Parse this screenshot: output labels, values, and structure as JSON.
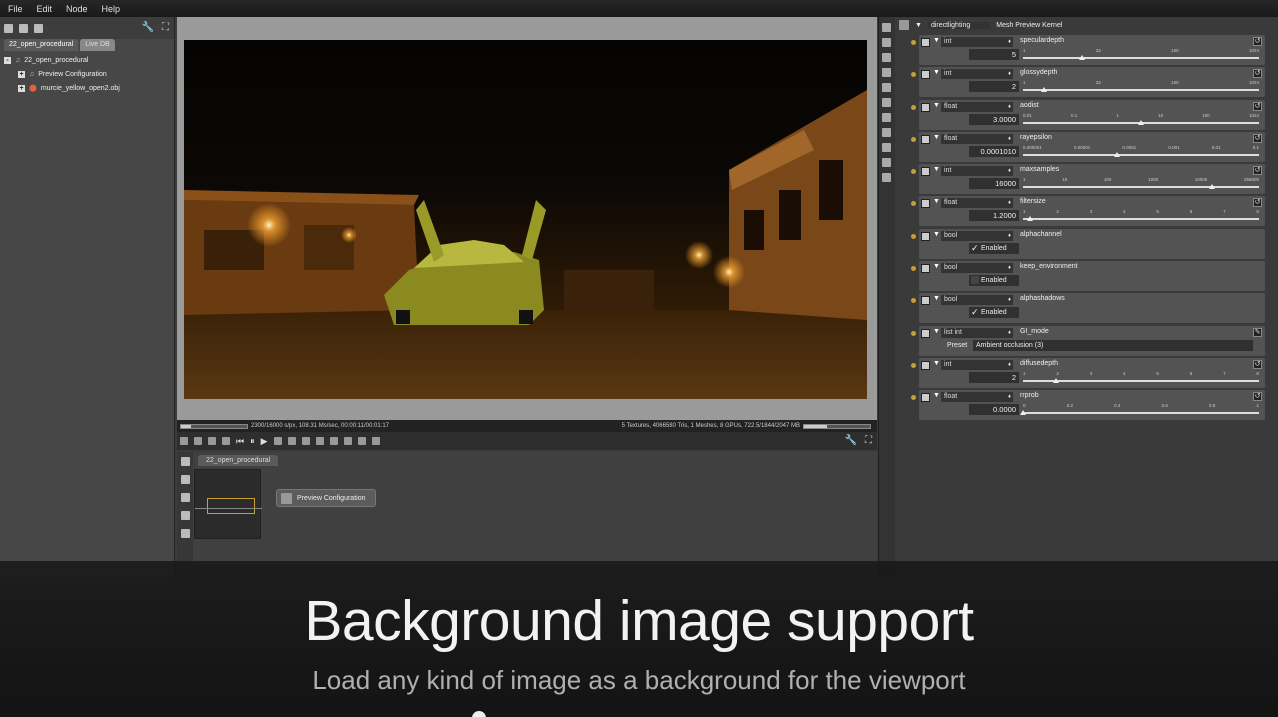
{
  "menu": {
    "file": "File",
    "edit": "Edit",
    "node": "Node",
    "help": "Help"
  },
  "left": {
    "tab_active": "22_open_procedural",
    "tab_inactive": "Live DB",
    "tree": {
      "root": "22_open_procedural",
      "child1": "Preview Configuration",
      "child2": "murcie_yellow_open2.obj"
    }
  },
  "status": {
    "left": "2300/16000 s/px, 108.31 Ms/sec, 00:00:11/00:01:17",
    "right": "5 Textures, 4066580 Tris, 1 Meshes, 8 GPUs, 722.5/1844/2047 MB",
    "progress": 0.15,
    "mem": 0.35
  },
  "graph": {
    "tab": "22_open_procedural",
    "node": "Preview Configuration"
  },
  "kernel": {
    "type": "directlighting",
    "name": "Mesh Preview Kernel"
  },
  "params": [
    {
      "type": "int",
      "name": "speculardepth",
      "value": "5",
      "ticks": [
        "1",
        "32",
        "100",
        "1024"
      ],
      "pos": 0.25
    },
    {
      "type": "int",
      "name": "glossydepth",
      "value": "2",
      "ticks": [
        "1",
        "32",
        "100",
        "1024"
      ],
      "pos": 0.09
    },
    {
      "type": "float",
      "name": "aodist",
      "value": "3.0000",
      "ticks": [
        "0.01",
        "0.1",
        "1",
        "10",
        "100",
        "1024"
      ],
      "pos": 0.5
    },
    {
      "type": "float",
      "name": "rayepsilon",
      "value": "0.0001010",
      "ticks": [
        "0.000001",
        "0.00001",
        "0.0001",
        "0.001",
        "0.01",
        "0.1"
      ],
      "pos": 0.4
    },
    {
      "type": "int",
      "name": "maxsamples",
      "value": "16000",
      "ticks": [
        "1",
        "10",
        "100",
        "1000",
        "10000",
        "256000"
      ],
      "pos": 0.8
    },
    {
      "type": "float",
      "name": "filtersize",
      "value": "1.2000",
      "ticks": [
        "1",
        "2",
        "3",
        "4",
        "5",
        "6",
        "7",
        "8"
      ],
      "pos": 0.03
    },
    {
      "type": "bool",
      "name": "alphachannel",
      "checked": true,
      "label": "Enabled"
    },
    {
      "type": "bool",
      "name": "keep_environment",
      "checked": false,
      "label": "Enabled"
    },
    {
      "type": "bool",
      "name": "alphashadows",
      "checked": true,
      "label": "Enabled"
    },
    {
      "type": "list int",
      "name": "GI_mode",
      "preset_label": "Preset",
      "preset": "Ambient occlusion (3)"
    },
    {
      "type": "int",
      "name": "diffusedepth",
      "value": "2",
      "ticks": [
        "1",
        "2",
        "3",
        "4",
        "5",
        "6",
        "7",
        "8"
      ],
      "pos": 0.14
    },
    {
      "type": "float",
      "name": "rrprob",
      "value": "0.0000",
      "ticks": [
        "0",
        "0.2",
        "0.4",
        "0.6",
        "0.8",
        "1"
      ],
      "pos": 0.0
    }
  ],
  "overlay": {
    "title": "Background image support",
    "subtitle": "Load any kind of image as a background for the viewport"
  }
}
